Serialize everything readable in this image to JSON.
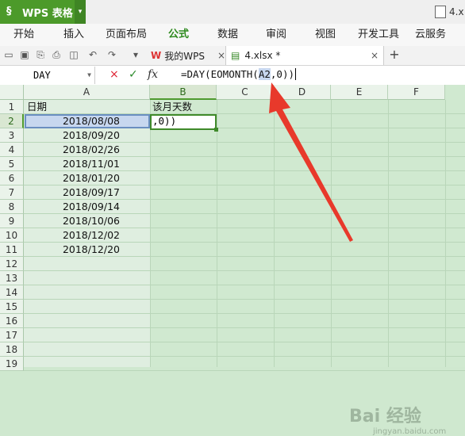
{
  "app": {
    "name": "WPS 表格",
    "file_title": "4.x"
  },
  "menu": [
    "开始",
    "插入",
    "页面布局",
    "公式",
    "数据",
    "审阅",
    "视图",
    "开发工具",
    "云服务"
  ],
  "menu_active_index": 3,
  "doc_tabs": [
    {
      "label": "我的WPS",
      "close": "×"
    },
    {
      "label": "4.xlsx *",
      "close": "×"
    }
  ],
  "add_tab": "+",
  "name_box": {
    "value": "DAY"
  },
  "formula_bar": {
    "cancel": "×",
    "confirm": "✓",
    "fx": "fx",
    "formula_prefix": "=DAY(EOMONTH(",
    "formula_ref": "A2",
    "formula_suffix": ",0))"
  },
  "columns": [
    "A",
    "B",
    "C",
    "D",
    "E",
    "F"
  ],
  "rows": [
    "1",
    "2",
    "3",
    "4",
    "5",
    "6",
    "7",
    "8",
    "9",
    "10",
    "11",
    "12",
    "13",
    "14",
    "15",
    "16",
    "17",
    "18",
    "19"
  ],
  "cells": {
    "A1": "日期",
    "B1": "该月天数",
    "B2_editing": ",0))",
    "dates": [
      "2018/08/08",
      "2018/09/20",
      "2018/02/26",
      "2018/11/01",
      "2018/01/20",
      "2018/09/17",
      "2018/09/14",
      "2018/10/06",
      "2018/12/02",
      "2018/12/20"
    ]
  },
  "watermark": {
    "main": "Bai 经验",
    "sub": "jingyan.baidu.com"
  },
  "colors": {
    "accent_green": "#4c9a2a",
    "arrow_red": "#e8392b",
    "selection_blue": "#c7d7ef"
  }
}
